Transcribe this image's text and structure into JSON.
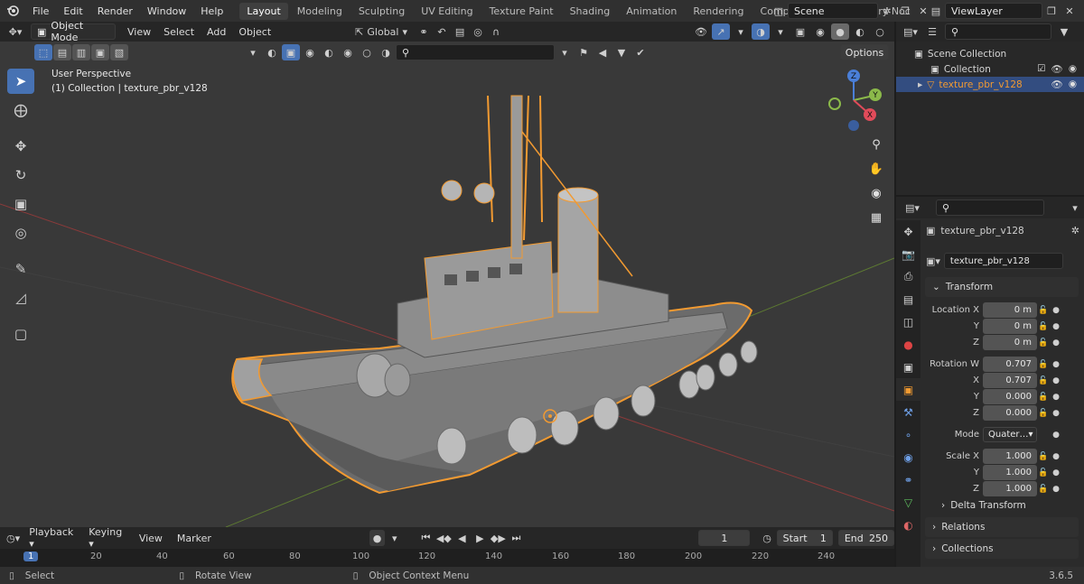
{
  "menu": {
    "items": [
      "File",
      "Edit",
      "Render",
      "Window",
      "Help"
    ],
    "workspaces": [
      "Layout",
      "Modeling",
      "Sculpting",
      "UV Editing",
      "Texture Paint",
      "Shading",
      "Animation",
      "Rendering",
      "Compositing",
      "Geometry Noc"
    ],
    "active_workspace": "Layout",
    "scene": "Scene",
    "view_layer": "ViewLayer"
  },
  "viewport_header": {
    "mode": "Object Mode",
    "menus": [
      "View",
      "Select",
      "Add",
      "Object"
    ],
    "orientation": "Global",
    "options": "Options"
  },
  "viewport": {
    "perspective": "User Perspective",
    "collection_info": "(1) Collection | texture_pbr_v128",
    "gizmo": {
      "x": "X",
      "y": "Y",
      "z": "Z"
    },
    "colors": {
      "bg": "#393939",
      "accent": "#4772b3",
      "selection": "#f29a31",
      "x_axis": "#e14b5a",
      "y_axis": "#8bb94a",
      "z_axis": "#4a7fd8"
    }
  },
  "outliner": {
    "scene_collection": "Scene Collection",
    "collection": "Collection",
    "object": "texture_pbr_v128"
  },
  "properties": {
    "object_name": "texture_pbr_v128",
    "data_name": "texture_pbr_v128",
    "transform_header": "Transform",
    "location_label": "Location X",
    "location": [
      "0 m",
      "0 m",
      "0 m"
    ],
    "rotation_label": "Rotation W",
    "rotation": [
      "0.707",
      "0.707",
      "0.000",
      "0.000"
    ],
    "mode_label": "Mode",
    "mode_value": "Quater…",
    "scale_label": "Scale X",
    "scale": [
      "1.000",
      "1.000",
      "1.000"
    ],
    "axis_y": "Y",
    "axis_z": "Z",
    "axis_x": "X",
    "delta": "Delta Transform",
    "relations": "Relations",
    "collections": "Collections"
  },
  "timeline": {
    "menus": [
      "Playback",
      "Keying",
      "View",
      "Marker"
    ],
    "current_frame": "1",
    "start_label": "Start",
    "start": "1",
    "end_label": "End",
    "end": "250",
    "ruler": [
      "1",
      "20",
      "40",
      "60",
      "80",
      "100",
      "120",
      "140",
      "160",
      "180",
      "200",
      "220",
      "240"
    ]
  },
  "status": {
    "select": "Select",
    "rotate": "Rotate View",
    "context": "Object Context Menu",
    "version": "3.6.5"
  }
}
